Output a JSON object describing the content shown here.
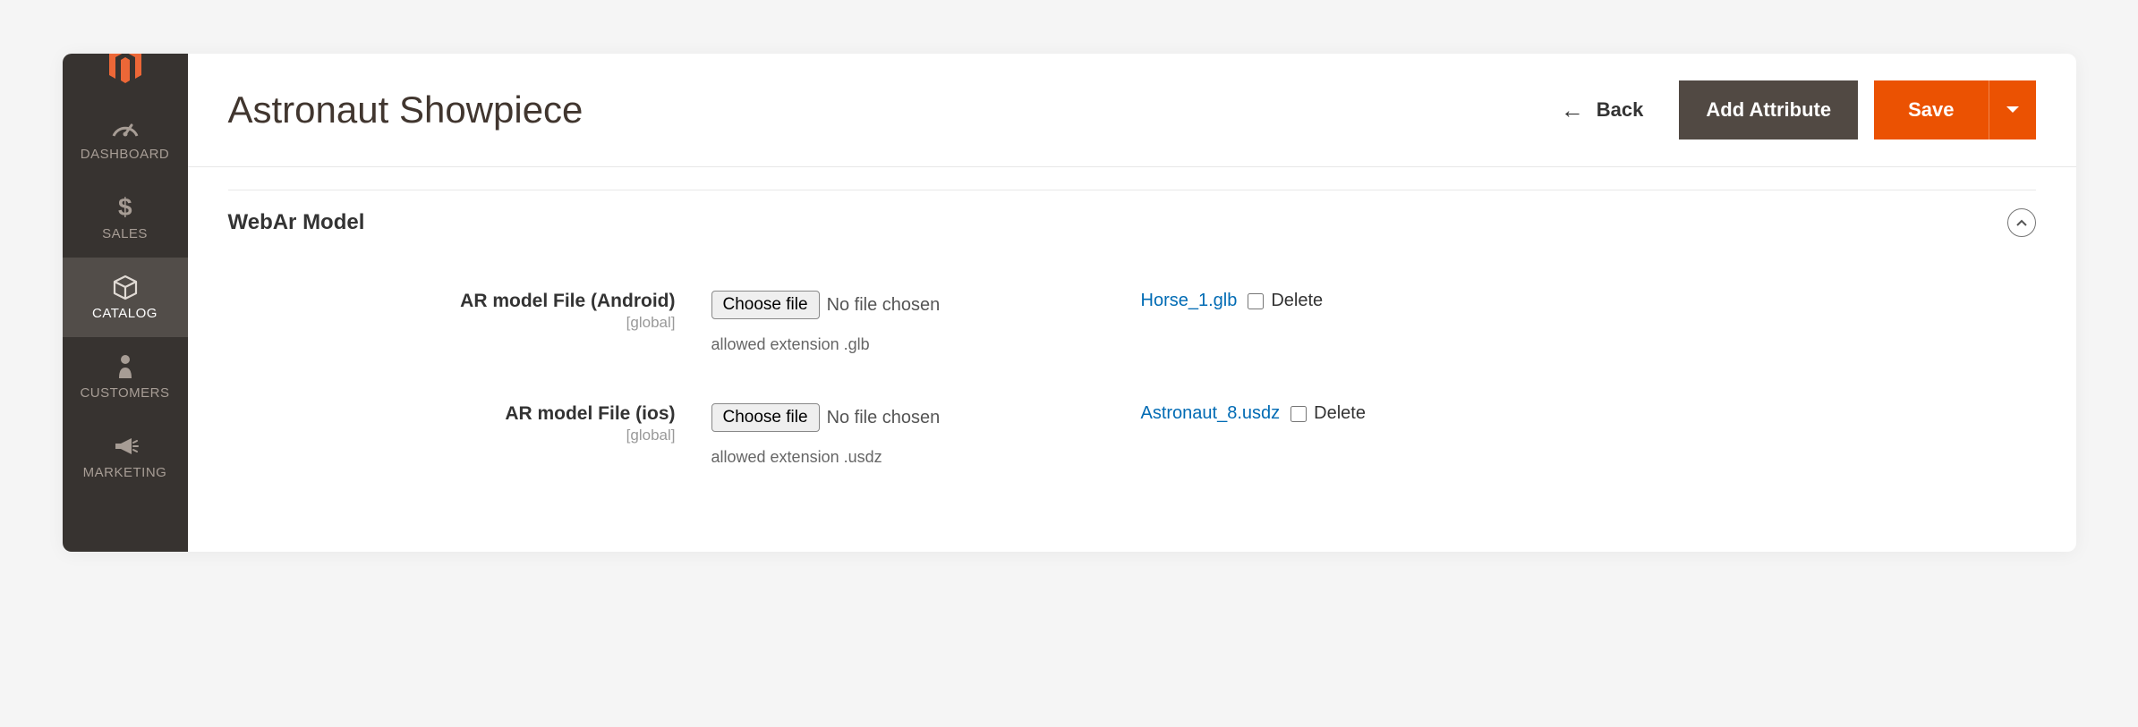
{
  "sidebar": {
    "items": [
      {
        "label": "DASHBOARD"
      },
      {
        "label": "SALES"
      },
      {
        "label": "CATALOG"
      },
      {
        "label": "CUSTOMERS"
      },
      {
        "label": "MARKETING"
      }
    ]
  },
  "header": {
    "title": "Astronaut Showpiece",
    "back_label": "Back",
    "add_attribute_label": "Add Attribute",
    "save_label": "Save"
  },
  "section": {
    "title": "WebAr Model"
  },
  "fields": {
    "android": {
      "label": "AR model File (Android)",
      "scope": "[global]",
      "choose_label": "Choose file",
      "file_status": "No file chosen",
      "hint": "allowed extension .glb",
      "filename": "Horse_1.glb",
      "delete_label": "Delete"
    },
    "ios": {
      "label": "AR model File (ios)",
      "scope": "[global]",
      "choose_label": "Choose file",
      "file_status": "No file chosen",
      "hint": "allowed extension .usdz",
      "filename": "Astronaut_8.usdz",
      "delete_label": "Delete"
    }
  }
}
